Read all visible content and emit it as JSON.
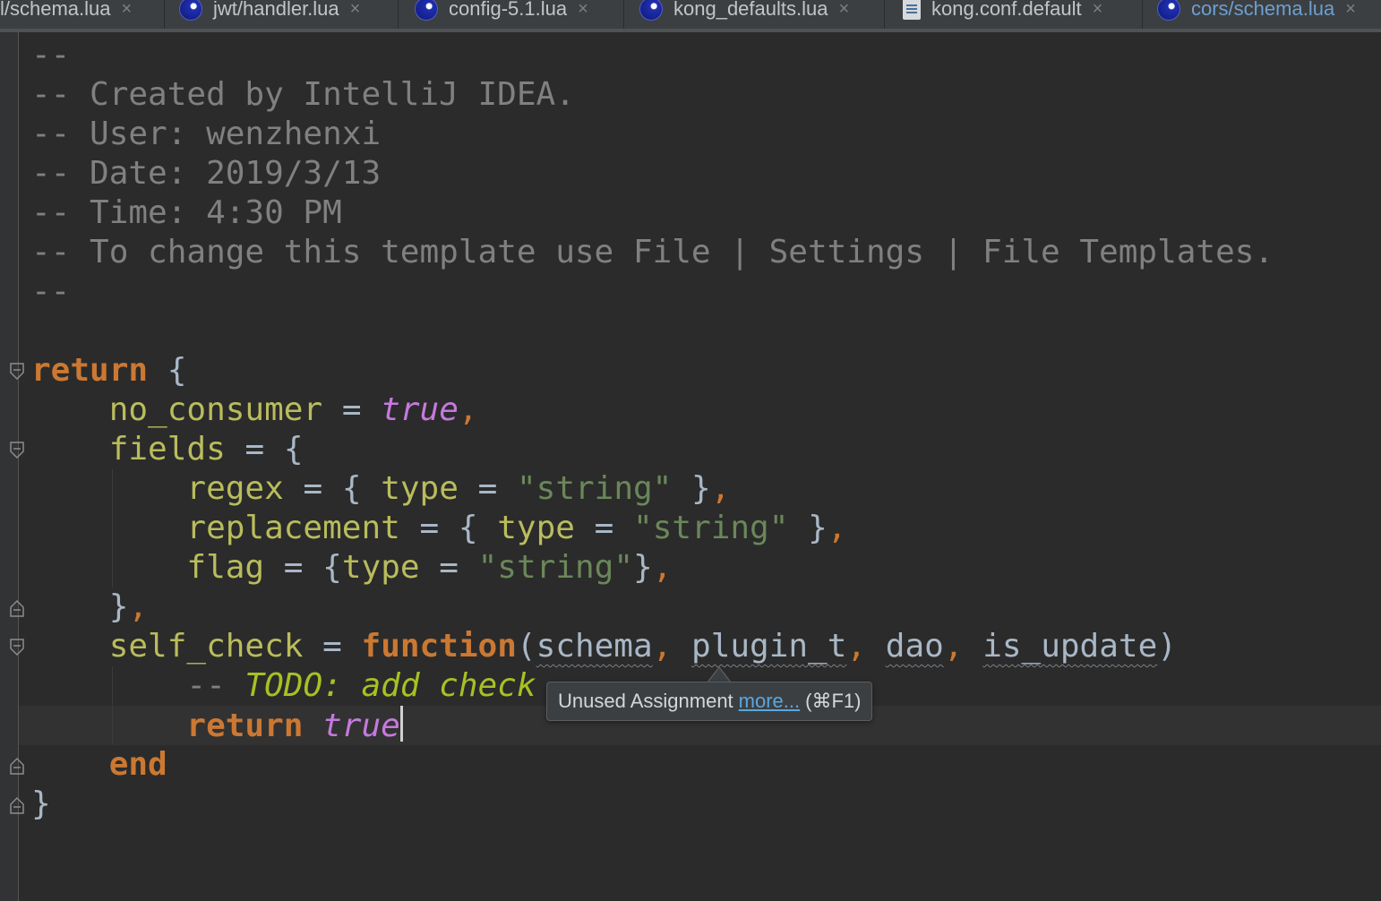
{
  "tabs": [
    {
      "label": "l/schema.lua",
      "icon": "none",
      "active": false
    },
    {
      "label": "jwt/handler.lua",
      "icon": "lua-file-icon",
      "active": false
    },
    {
      "label": "config-5.1.lua",
      "icon": "lua-file-icon",
      "active": false
    },
    {
      "label": "kong_defaults.lua",
      "icon": "lua-file-icon",
      "active": false
    },
    {
      "label": "kong.conf.default",
      "icon": "text-file-icon",
      "active": false
    },
    {
      "label": "cors/schema.lua",
      "icon": "lua-file-icon",
      "active": true
    }
  ],
  "tab_close_glyph": "×",
  "code": {
    "l1": "--",
    "l2": "-- Created by IntelliJ IDEA.",
    "l3": "-- User: wenzhenxi",
    "l4": "-- Date: 2019/3/13",
    "l5": "-- Time: 4:30 PM",
    "l6": "-- To change this template use File | Settings | File Templates.",
    "l7": "--",
    "kw_return": "return",
    "kw_function": "function",
    "kw_end": "end",
    "kw_true": "true",
    "id_no_consumer": "no_consumer",
    "id_fields": "fields",
    "id_regex": "regex",
    "id_replacement": "replacement",
    "id_flag": "flag",
    "id_type": "type",
    "id_self_check": "self_check",
    "str_string": "\"string\"",
    "param_schema": "schema",
    "param_plugin_t": "plugin_t",
    "param_dao": "dao",
    "param_is_update": "is_update",
    "comment_prefix": "-- ",
    "todo_text": "TODO: add check"
  },
  "tooltip": {
    "text": "Unused Assignment",
    "link": "more...",
    "shortcut": "(⌘F1)"
  },
  "colors": {
    "background": "#2b2b2b",
    "comment": "#808080",
    "keyword": "#cc7832",
    "identifier": "#b9bc5c",
    "boolean": "#c679dd",
    "string": "#6a8759",
    "todo": "#a8c023",
    "active_tab": "#6d9fd1"
  }
}
